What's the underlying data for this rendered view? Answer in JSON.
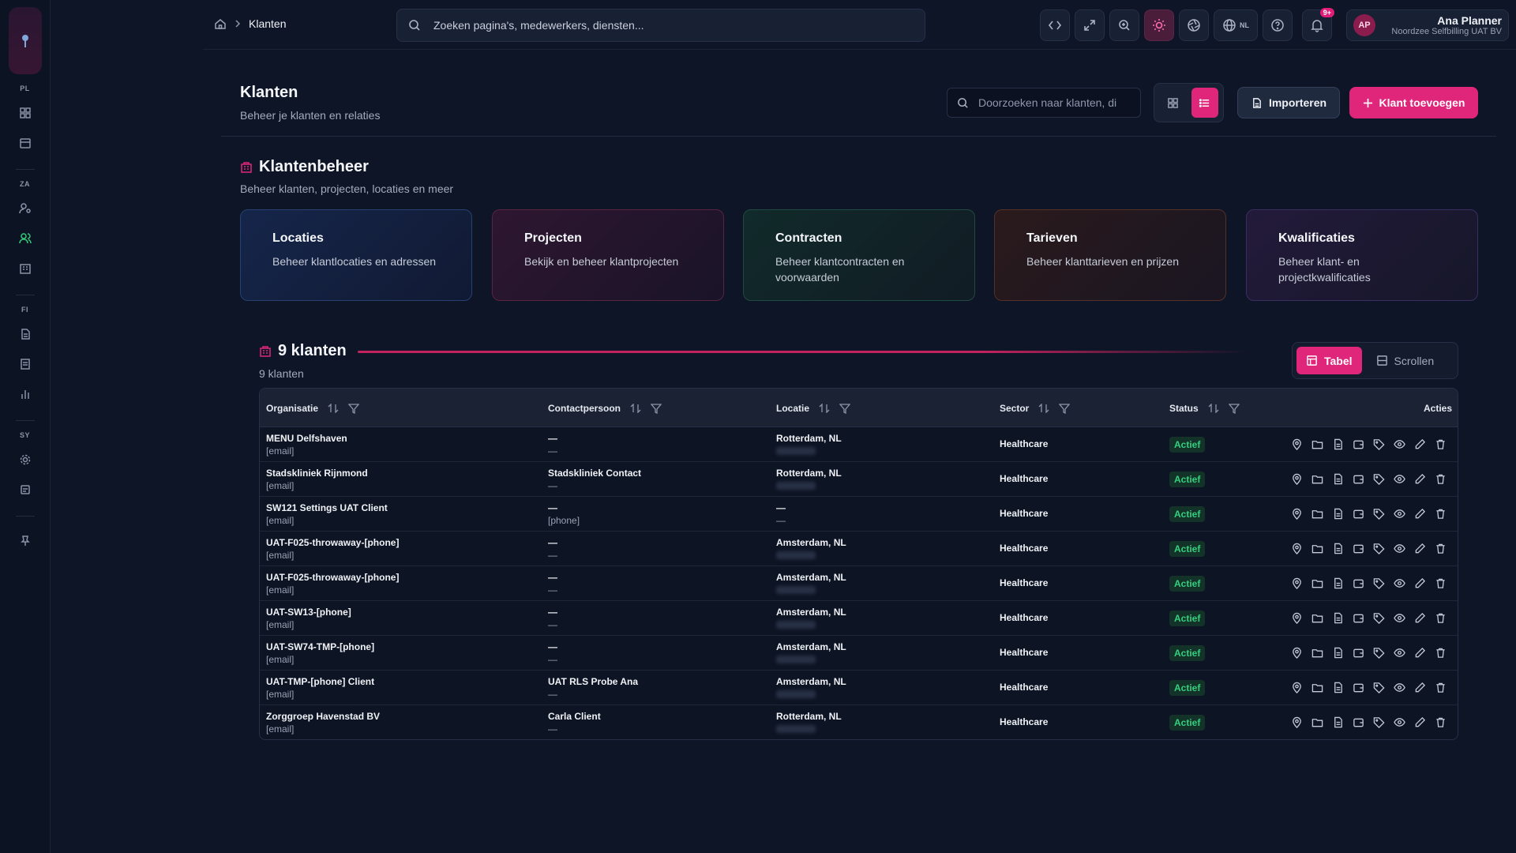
{
  "breadcrumb": {
    "current": "Klanten"
  },
  "top_search": {
    "placeholder": "Zoeken pagina's, medewerkers, diensten..."
  },
  "topbar": {
    "language": "NL",
    "notifications_badge": "9+"
  },
  "user": {
    "initials": "AP",
    "name": "Ana Planner",
    "org": "Noordzee Selfbilling UAT BV"
  },
  "rail": {
    "groups": [
      "PL",
      "ZA",
      "FI",
      "SY"
    ]
  },
  "page": {
    "title": "Klanten",
    "subtitle": "Beheer je klanten en relaties"
  },
  "list_search": {
    "placeholder": "Doorzoeken naar klanten, di"
  },
  "buttons": {
    "import": "Importeren",
    "add": "Klant toevoegen"
  },
  "klantenbeheer": {
    "title": "Klantenbeheer",
    "subtitle": "Beheer klanten, projecten, locaties en meer",
    "cards": [
      {
        "title": "Locaties",
        "desc": "Beheer klantlocaties en adressen"
      },
      {
        "title": "Projecten",
        "desc": "Bekijk en beheer klantprojecten"
      },
      {
        "title": "Contracten",
        "desc": "Beheer klantcontracten en voorwaarden"
      },
      {
        "title": "Tarieven",
        "desc": "Beheer klanttarieven en prijzen"
      },
      {
        "title": "Kwalificaties",
        "desc": "Beheer klant- en projectkwalificaties"
      }
    ]
  },
  "table_section": {
    "title": "9 klanten",
    "count": "9 klanten",
    "modes": [
      "Tabel",
      "Scrollen"
    ],
    "columns": [
      "Organisatie",
      "Contactpersoon",
      "Locatie",
      "Sector",
      "Status",
      "Acties"
    ],
    "rows": [
      {
        "org": "MENU Delfshaven",
        "email": "[email]",
        "contact": "—",
        "contact_sub": "—",
        "loc": "Rotterdam, NL",
        "sector": "Healthcare",
        "status": "Actief"
      },
      {
        "org": "Stadskliniek Rijnmond",
        "email": "[email]",
        "contact": "Stadskliniek Contact",
        "contact_sub": "—",
        "loc": "Rotterdam, NL",
        "sector": "Healthcare",
        "status": "Actief"
      },
      {
        "org": "SW121 Settings UAT Client",
        "email": "[email]",
        "contact": "—",
        "contact_sub": "[phone]",
        "loc": "—",
        "loc_sub": "—",
        "sector": "Healthcare",
        "status": "Actief"
      },
      {
        "org": "UAT-F025-throwaway-[phone]",
        "email": "[email]",
        "contact": "—",
        "contact_sub": "—",
        "loc": "Amsterdam, NL",
        "sector": "Healthcare",
        "status": "Actief"
      },
      {
        "org": "UAT-F025-throwaway-[phone]",
        "email": "[email]",
        "contact": "—",
        "contact_sub": "—",
        "loc": "Amsterdam, NL",
        "sector": "Healthcare",
        "status": "Actief"
      },
      {
        "org": "UAT-SW13-[phone]",
        "email": "[email]",
        "contact": "—",
        "contact_sub": "—",
        "loc": "Amsterdam, NL",
        "sector": "Healthcare",
        "status": "Actief"
      },
      {
        "org": "UAT-SW74-TMP-[phone]",
        "email": "[email]",
        "contact": "—",
        "contact_sub": "—",
        "loc": "Amsterdam, NL",
        "sector": "Healthcare",
        "status": "Actief"
      },
      {
        "org": "UAT-TMP-[phone] Client",
        "email": "[email]",
        "contact": "UAT RLS Probe Ana",
        "contact_sub": "—",
        "loc": "Amsterdam, NL",
        "sector": "Healthcare",
        "status": "Actief"
      },
      {
        "org": "Zorggroep Havenstad BV",
        "email": "[email]",
        "contact": "Carla Client",
        "contact_sub": "—",
        "loc": "Rotterdam, NL",
        "sector": "Healthcare",
        "status": "Actief"
      }
    ]
  }
}
